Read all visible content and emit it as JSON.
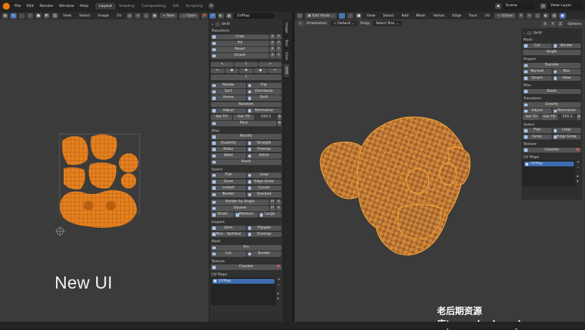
{
  "menu": [
    "File",
    "Edit",
    "Render",
    "Window",
    "Help"
  ],
  "workspaces": [
    {
      "label": "Layout",
      "active": true
    },
    {
      "label": "Shading",
      "active": false
    },
    {
      "label": "Compositing",
      "active": false
    },
    {
      "label": "GN",
      "active": false
    },
    {
      "label": "Scripting",
      "active": false
    }
  ],
  "scene_label": "Scene",
  "view_layer_label": "View Layer",
  "uv_header": {
    "menus": [
      "View",
      "Select",
      "Image",
      "UV"
    ],
    "new_label": "New",
    "open_label": "Open",
    "uvmap_field": "UVMap"
  },
  "viewport_header": {
    "mode": "Edit Mode",
    "menus": [
      "View",
      "Select",
      "Add",
      "Mesh",
      "Vertex",
      "Edge",
      "Face",
      "UV"
    ],
    "transform_orientation": "Global",
    "orientation_label": "Orientation:",
    "orientation_value": "Default",
    "drag_label": "Drag:",
    "drag_value": "Select Box",
    "axes": [
      "X",
      "Y",
      "Z"
    ],
    "options_label": "Options"
  },
  "uv_panel": {
    "title": "UniV",
    "transform_title": "Transform",
    "transform_rows": [
      "Crop",
      "Fill",
      "Reset",
      "Orient"
    ],
    "xy": [
      "X",
      "Y"
    ],
    "ops_pairs": [
      [
        "Rotate",
        "Flip"
      ],
      [
        "Sort",
        "Distribute"
      ],
      [
        "Home",
        "Shift"
      ]
    ],
    "random_label": "Random",
    "adjust_label": "Adjust",
    "normalize_label": "Normalize",
    "set_td": "Set TD",
    "get_td": "Get TD",
    "td_value": "150.2",
    "pack_label": "Pack",
    "misc_title": "Misc",
    "rectify_label": "Rectify",
    "misc_pairs": [
      [
        "Quadrify",
        "Straight"
      ],
      [
        "Relax",
        "Unwrap"
      ],
      [
        "Weld",
        "Stitch"
      ]
    ],
    "stack_label": "Stack",
    "select_title": "Select",
    "select_pairs": [
      [
        "Flat",
        "Loop"
      ],
      [
        "Grow",
        "Edge Grow"
      ],
      [
        "Linked",
        "Cursor"
      ],
      [
        "Border",
        "Stacked"
      ]
    ],
    "border_by_angle": "Border by Angle",
    "square_label": "Square",
    "size_triple": [
      "Small",
      "Medium",
      "Large"
    ],
    "hv": [
      "H",
      "V"
    ],
    "inspect_title": "Inspect",
    "inspect_pairs": [
      [
        "Zero",
        "Flipped"
      ],
      [
        "Non - Splitted",
        "Overlap"
      ]
    ],
    "mark_title": "Mark",
    "pin_label": "Pin",
    "mark_pair": [
      "Cut",
      "Border"
    ],
    "texture_title": "Texture",
    "checker_label": "Checker",
    "uvmaps_title": "UV Maps",
    "uvmap_item": "UVMap"
  },
  "uv_side_tabs": [
    "Image",
    "Tool",
    "View",
    "UniV"
  ],
  "vp_panel": {
    "title": "UniV",
    "mark_title": "Mark",
    "mark_pair": [
      "Cut",
      "Border"
    ],
    "angle_label": "Angle",
    "project_title": "Project",
    "transfer_label": "Transfer",
    "project_pairs": [
      [
        "Normal",
        "Box"
      ],
      [
        "Smart",
        "View"
      ]
    ],
    "misc_title": "Misc",
    "stack_label": "Stack",
    "transform_title": "Transform",
    "gravity_label": "Gravity",
    "adjust_label": "Adjust",
    "normalize_label": "Normalize",
    "set_td": "Set TD",
    "get_td": "Get TD",
    "td_value": "150.2",
    "select_title": "Select",
    "select_pairs": [
      [
        "Flat",
        "Loop"
      ],
      [
        "Grow",
        "Edge Grow"
      ]
    ],
    "texture_title": "Texture",
    "checker_label": "Checker",
    "uvmaps_title": "UV Maps",
    "uvmap_item": "UVMap"
  },
  "overlay_caption": "New UI",
  "watermark": "老后期资源库|www.laohouqi.com",
  "colors": {
    "accent": "#4772b3",
    "mesh_orange": "#e8902a",
    "uv_orange": "#e5801f",
    "bg": "#3b3b3b",
    "panel": "#303030"
  }
}
